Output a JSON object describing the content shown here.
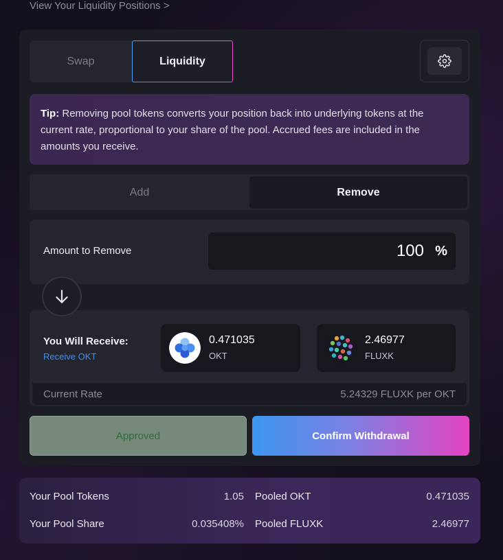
{
  "top_link": "View Your Liquidity Positions >",
  "mode_tabs": {
    "swap": "Swap",
    "liquidity": "Liquidity"
  },
  "settings": {
    "icon": "gear-icon"
  },
  "tip": {
    "label": "Tip:",
    "text": " Removing pool tokens converts your position back into underlying tokens at the current rate, proportional to your share of the pool. Accrued fees are included in the amounts you receive."
  },
  "action_tabs": {
    "add": "Add",
    "remove": "Remove"
  },
  "amount": {
    "label": "Amount to Remove",
    "value": "100",
    "unit": "%"
  },
  "receive": {
    "title": "You Will Receive:",
    "link": "Receive OKT",
    "tokens": [
      {
        "amount": "0.471035",
        "symbol": "OKT"
      },
      {
        "amount": "2.46977",
        "symbol": "FLUXK"
      }
    ],
    "rate_label": "Current Rate",
    "rate_value": "5.24329 FLUXK per OKT"
  },
  "buttons": {
    "approved": "Approved",
    "confirm": "Confirm Withdrawal"
  },
  "pool": {
    "tokens_label": "Your Pool Tokens",
    "tokens_value": "1.05",
    "share_label": "Your Pool Share",
    "share_value": "0.035408%",
    "pooled_okt_label": "Pooled OKT",
    "pooled_okt_value": "0.471035",
    "pooled_fluxk_label": "Pooled FLUXK",
    "pooled_fluxk_value": "2.46977"
  },
  "colors": {
    "accent_blue": "#3c96ef",
    "accent_pink": "#e544c2",
    "approved_bg": "#76897a",
    "approved_text": "#2c6b3b"
  }
}
